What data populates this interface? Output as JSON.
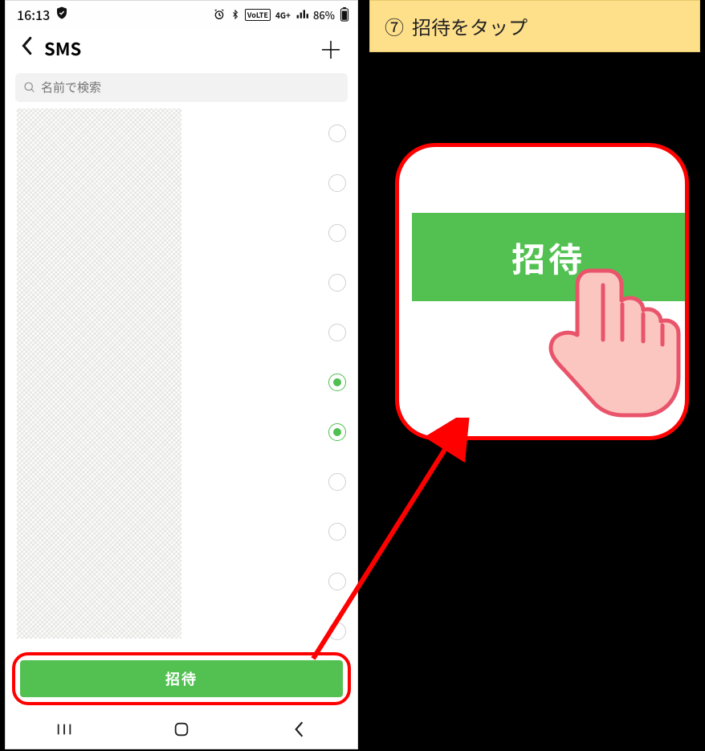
{
  "statusbar": {
    "time": "16:13",
    "battery": "86%"
  },
  "titlebar": {
    "title": "SMS"
  },
  "search": {
    "placeholder": "名前で検索"
  },
  "list": {
    "rows": [
      {
        "checked": false
      },
      {
        "checked": false
      },
      {
        "checked": false
      },
      {
        "checked": false
      },
      {
        "checked": false
      },
      {
        "checked": true
      },
      {
        "checked": true
      },
      {
        "checked": false
      },
      {
        "checked": false
      },
      {
        "checked": false
      },
      {
        "checked": false
      }
    ]
  },
  "invite": {
    "label": "招待"
  },
  "instruction": {
    "step": "⑦",
    "text": "招待をタップ"
  },
  "callout": {
    "label": "招待"
  },
  "colors": {
    "accent_green": "#52c152",
    "highlight_red": "#ff0000",
    "panel_yellow": "#fee08b"
  }
}
